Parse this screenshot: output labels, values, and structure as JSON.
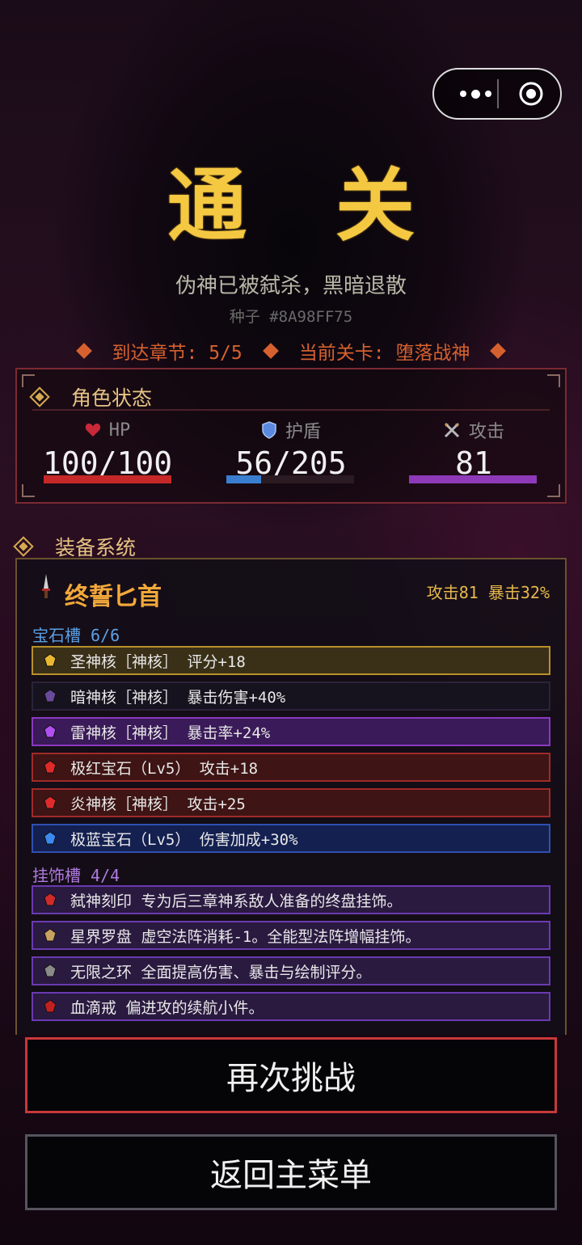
{
  "title": "通关",
  "subtitle": "伪神已被弑杀，黑暗退散",
  "seed": "种子 #8A98FF75",
  "chapter": "到达章节: 5/5",
  "level": "当前关卡: 堕落战神",
  "status": {
    "title": "角色状态",
    "hp_label": "HP",
    "hp_value": "100/100",
    "hp_fraction": 1.0,
    "shield_label": "护盾",
    "shield_value": "56/205",
    "shield_fraction": 0.27,
    "attack_label": "攻击",
    "attack_value": "81",
    "attack_fraction": 1.0
  },
  "equipment": {
    "title": "装备系统",
    "weapon_name": "终誓匕首",
    "weapon_stats": "攻击81 暴击32%",
    "gem_section": "宝石槽 6/6",
    "gems": [
      {
        "text": "圣神核［神核］  评分+18",
        "icon": "gold-gem-icon",
        "border": "#b8902a",
        "bg": "#3a3018",
        "iconColor": "#e8b830"
      },
      {
        "text": "暗神核［神核］  暴击伤害+40%",
        "icon": "dark-gem-icon",
        "border": "#2a2438",
        "bg": "#16121e",
        "iconColor": "#6a4a9a"
      },
      {
        "text": "雷神核［神核］  暴击率+24%",
        "icon": "purple-gem-icon",
        "border": "#8a3ac0",
        "bg": "#3a1a58",
        "iconColor": "#b050f0"
      },
      {
        "text": "极红宝石（Lv5） 攻击+18",
        "icon": "red-gem-icon",
        "border": "#a02a2a",
        "bg": "#3e1414",
        "iconColor": "#e02a2a"
      },
      {
        "text": "炎神核［神核］  攻击+25",
        "icon": "flame-gem-icon",
        "border": "#a02a2a",
        "bg": "#3e1414",
        "iconColor": "#e02a2a"
      },
      {
        "text": "极蓝宝石（Lv5） 伤害加成+30%",
        "icon": "blue-gem-icon",
        "border": "#3050b0",
        "bg": "#142050",
        "iconColor": "#3a8af0"
      }
    ],
    "charm_section": "挂饰槽 4/4",
    "charms": [
      {
        "text": "弑神刻印  专为后三章神系敌人准备的终盘挂饰。",
        "icon": "seal-icon",
        "iconColor": "#d02a2a"
      },
      {
        "text": "星界罗盘  虚空法阵消耗-1。全能型法阵增幅挂饰。",
        "icon": "compass-icon",
        "iconColor": "#c8a060"
      },
      {
        "text": "无限之环  全面提高伤害、暴击与绘制评分。",
        "icon": "infinity-ring-icon",
        "iconColor": "#8a8a8a"
      },
      {
        "text": "血滴戒  偏进攻的续航小件。",
        "icon": "blood-ring-icon",
        "iconColor": "#c02020"
      }
    ]
  },
  "buttons": {
    "retry": "再次挑战",
    "menu": "返回主菜单"
  },
  "colors": {
    "title": "#f5c842",
    "accent_orange": "#d6612e",
    "hp_bar": "#c62828",
    "shield_bar": "#3a7ed0",
    "attack_bar": "#8e3ab8",
    "gem_section": "#5aa0e6",
    "charm_section": "#b07ae0"
  }
}
